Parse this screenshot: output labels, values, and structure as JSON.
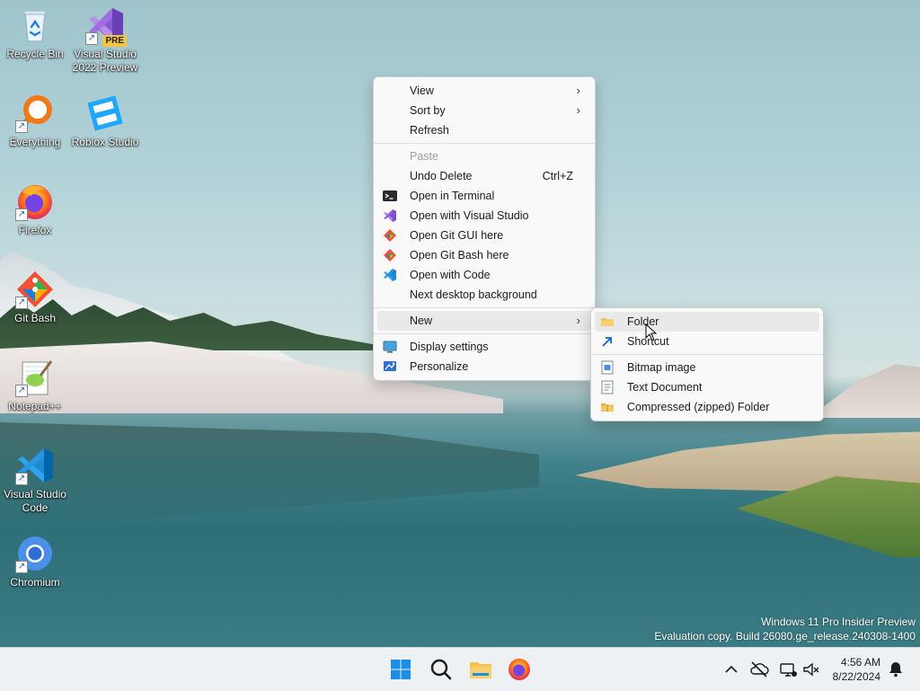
{
  "desktop_icons": [
    {
      "id": "recycle-bin",
      "label": "Recycle Bin",
      "icon": "recycle-bin-icon",
      "shortcut": false
    },
    {
      "id": "visual-studio-2022-preview",
      "label": "Visual Studio 2022 Preview",
      "icon": "visual-studio-preview-icon",
      "badge": "PRE",
      "shortcut": true
    },
    {
      "id": "everything",
      "label": "Everything",
      "icon": "everything-search-icon",
      "shortcut": true
    },
    {
      "id": "roblox-studio",
      "label": "Roblox Studio",
      "icon": "roblox-studio-icon",
      "shortcut": false
    },
    {
      "id": "firefox",
      "label": "Firefox",
      "icon": "firefox-icon",
      "shortcut": true
    },
    {
      "id": "git-bash",
      "label": "Git Bash",
      "icon": "git-bash-icon",
      "shortcut": true
    },
    {
      "id": "notepad-plus-plus",
      "label": "Notepad++",
      "icon": "notepad-plus-plus-icon",
      "shortcut": true
    },
    {
      "id": "visual-studio-code",
      "label": "Visual Studio Code",
      "icon": "vscode-icon",
      "shortcut": true
    },
    {
      "id": "chromium",
      "label": "Chromium",
      "icon": "chromium-icon",
      "shortcut": true
    }
  ],
  "context_menu": {
    "view": {
      "label": "View",
      "submenu": true
    },
    "sort_by": {
      "label": "Sort by",
      "submenu": true
    },
    "refresh": {
      "label": "Refresh"
    },
    "paste": {
      "label": "Paste",
      "disabled": true
    },
    "undo_delete": {
      "label": "Undo Delete",
      "accel": "Ctrl+Z"
    },
    "open_terminal": {
      "label": "Open in Terminal",
      "icon": "terminal-icon"
    },
    "open_visual_studio": {
      "label": "Open with Visual Studio",
      "icon": "visual-studio-icon"
    },
    "open_git_gui": {
      "label": "Open Git GUI here",
      "icon": "git-icon"
    },
    "open_git_bash": {
      "label": "Open Git Bash here",
      "icon": "git-icon"
    },
    "open_code": {
      "label": "Open with Code",
      "icon": "vscode-icon"
    },
    "next_background": {
      "label": "Next desktop background"
    },
    "new": {
      "label": "New",
      "submenu": true,
      "active": true
    },
    "display_settings": {
      "label": "Display settings",
      "icon": "display-icon"
    },
    "personalize": {
      "label": "Personalize",
      "icon": "personalize-icon"
    }
  },
  "new_submenu": {
    "folder": {
      "label": "Folder",
      "icon": "folder-icon",
      "hovered": true
    },
    "shortcut": {
      "label": "Shortcut",
      "icon": "shortcut-icon"
    },
    "bitmap": {
      "label": "Bitmap image",
      "icon": "bitmap-icon"
    },
    "text_document": {
      "label": "Text Document",
      "icon": "text-document-icon"
    },
    "zip_folder": {
      "label": "Compressed (zipped) Folder",
      "icon": "zip-folder-icon"
    }
  },
  "watermark": {
    "line1": "Windows 11 Pro Insider Preview",
    "line2": "Evaluation copy. Build 26080.ge_release.240308-1400"
  },
  "taskbar": {
    "apps": [
      "start-icon",
      "search-icon",
      "file-explorer-icon",
      "firefox-icon"
    ],
    "tray": [
      "chevron-up-icon",
      "onedrive-offline-icon",
      "network-icon",
      "volume-muted-icon",
      "notification-bell-icon"
    ],
    "time": "4:56 AM",
    "date": "8/22/2024"
  },
  "colors": {
    "menu_bg": "#f9f9f9",
    "taskbar_bg": "#eef1f4",
    "folder_yellow": "#f3c24f",
    "accent_blue": "#0a64c2"
  }
}
